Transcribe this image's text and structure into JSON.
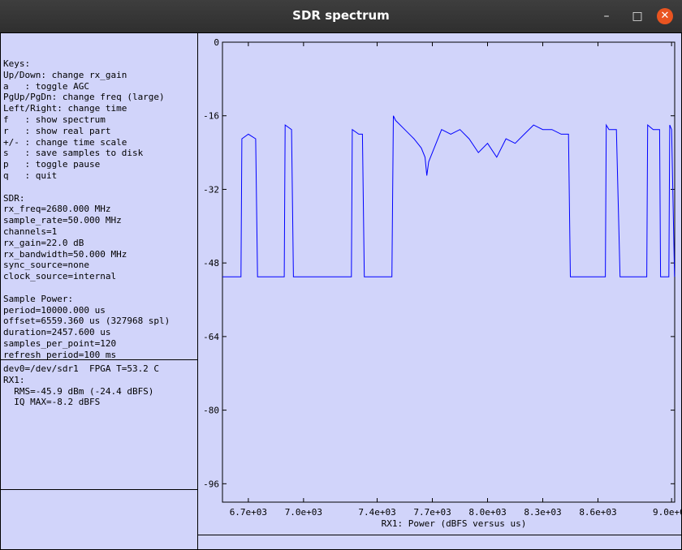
{
  "window": {
    "title": "SDR spectrum",
    "min_glyph": "–",
    "max_glyph": "□",
    "close_glyph": "✕"
  },
  "info_text": "Keys:\nUp/Down: change rx_gain\na   : toggle AGC\nPgUp/PgDn: change freq (large)\nLeft/Right: change time\nf   : show spectrum\nr   : show real part\n+/- : change time scale\ns   : save samples to disk\np   : toggle pause\nq   : quit\n\nSDR:\nrx_freq=2680.000 MHz\nsample_rate=50.000 MHz\nchannels=1\nrx_gain=22.0 dB\nrx_bandwidth=50.000 MHz\nsync_source=none\nclock_source=internal\n\nSample Power:\nperiod=10000.000 us\noffset=6559.360 us (327968 spl)\nduration=2457.600 us\nsamples_per_point=120\nrefresh_period=100 ms",
  "status_text": "dev0=/dev/sdr1  FPGA T=53.2 C\nRX1:\n  RMS=-45.9 dBm (-24.4 dBFS)\n  IQ MAX=-8.2 dBFS",
  "colors": {
    "background": "#d1d4fa",
    "trace": "#0000ff",
    "titlebar": "#333333",
    "close_button": "#e95420"
  },
  "chart_data": {
    "type": "line",
    "xlabel": "RX1: Power (dBFS versus us)",
    "ylabel": "",
    "xlim": [
      6559.36,
      9016.96
    ],
    "ylim": [
      -100,
      0
    ],
    "y_ticks": [
      0,
      -16,
      -32,
      -48,
      -64,
      -80,
      -96
    ],
    "y_tick_labels": [
      "0",
      "-16",
      "-32",
      "-48",
      "-64",
      "-80",
      "-96"
    ],
    "x_ticks": [
      6700,
      7000,
      7400,
      7700,
      8000,
      8300,
      8600,
      9000
    ],
    "x_tick_labels": [
      "6.7e+03",
      "7.0e+03",
      "7.4e+03",
      "7.7e+03",
      "8.0e+03",
      "8.3e+03",
      "8.6e+03",
      "9.0e+03"
    ],
    "series": [
      {
        "x": [
          6560,
          6600,
          6650,
          6660,
          6665,
          6700,
          6740,
          6750,
          6800,
          6850,
          6890,
          6895,
          6900,
          6935,
          6945,
          7000,
          7050,
          7150,
          7250,
          7260,
          7265,
          7300,
          7320,
          7330,
          7400,
          7450,
          7480,
          7488,
          7500,
          7550,
          7600,
          7640,
          7660,
          7670,
          7680,
          7720,
          7750,
          7800,
          7850,
          7900,
          7950,
          8000,
          8050,
          8100,
          8150,
          8200,
          8250,
          8300,
          8350,
          8400,
          8440,
          8450,
          8460,
          8500,
          8600,
          8640,
          8645,
          8660,
          8700,
          8720,
          8725,
          8800,
          8860,
          8865,
          8870,
          8900,
          8935,
          8940,
          8960,
          8985,
          8990,
          9000,
          9016
        ],
        "y": [
          -51,
          -51,
          -51,
          -51,
          -21,
          -20,
          -21,
          -51,
          -51,
          -51,
          -51,
          -51,
          -18,
          -19,
          -51,
          -51,
          -51,
          -51,
          -51,
          -51,
          -19,
          -20,
          -20,
          -51,
          -51,
          -51,
          -51,
          -16,
          -17,
          -19,
          -21,
          -23,
          -25,
          -29,
          -26,
          -22,
          -19,
          -20,
          -19,
          -21,
          -24,
          -22,
          -25,
          -21,
          -22,
          -20,
          -18,
          -19,
          -19,
          -20,
          -20,
          -51,
          -51,
          -51,
          -51,
          -51,
          -18,
          -19,
          -19,
          -51,
          -51,
          -51,
          -51,
          -51,
          -18,
          -19,
          -19,
          -51,
          -51,
          -51,
          -18,
          -19,
          -51
        ]
      }
    ]
  }
}
